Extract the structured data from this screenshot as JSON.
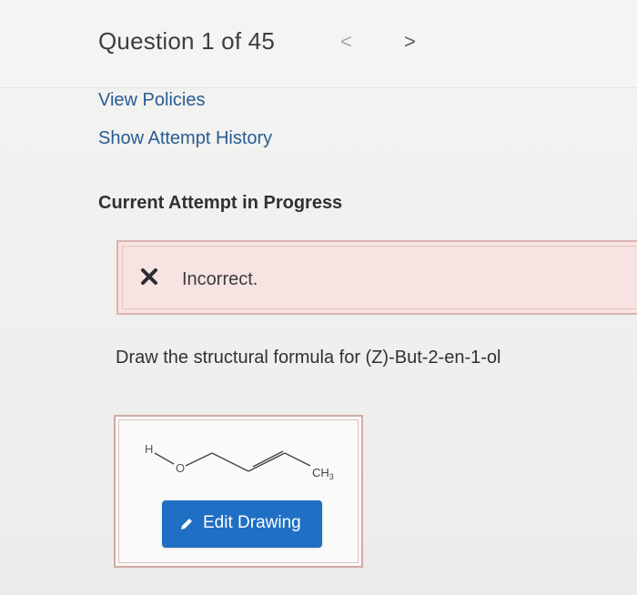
{
  "header": {
    "question_title": "Question 1 of 45",
    "prev_glyph": "<",
    "next_glyph": ">"
  },
  "links": {
    "view_policies": "View Policies",
    "show_attempt_history": "Show Attempt History"
  },
  "attempt_status": "Current Attempt in Progress",
  "feedback": {
    "status_text": "Incorrect.",
    "status_icon": "x-mark-icon",
    "colors": {
      "background": "#f7e3e1",
      "border": "#d9b3af"
    }
  },
  "question": {
    "prompt": "Draw the structural formula for (Z)-But-2-en-1-ol"
  },
  "drawing": {
    "atom_h": "H",
    "atom_o": "O",
    "group_ch3_main": "CH",
    "group_ch3_sub": "3",
    "edit_button_label": "Edit Drawing",
    "edit_icon": "pencil-icon",
    "colors": {
      "button": "#1f6fc4",
      "box_border": "#d2a9a5"
    }
  },
  "colors": {
    "link": "#2a5c93",
    "text": "#2f3136"
  }
}
